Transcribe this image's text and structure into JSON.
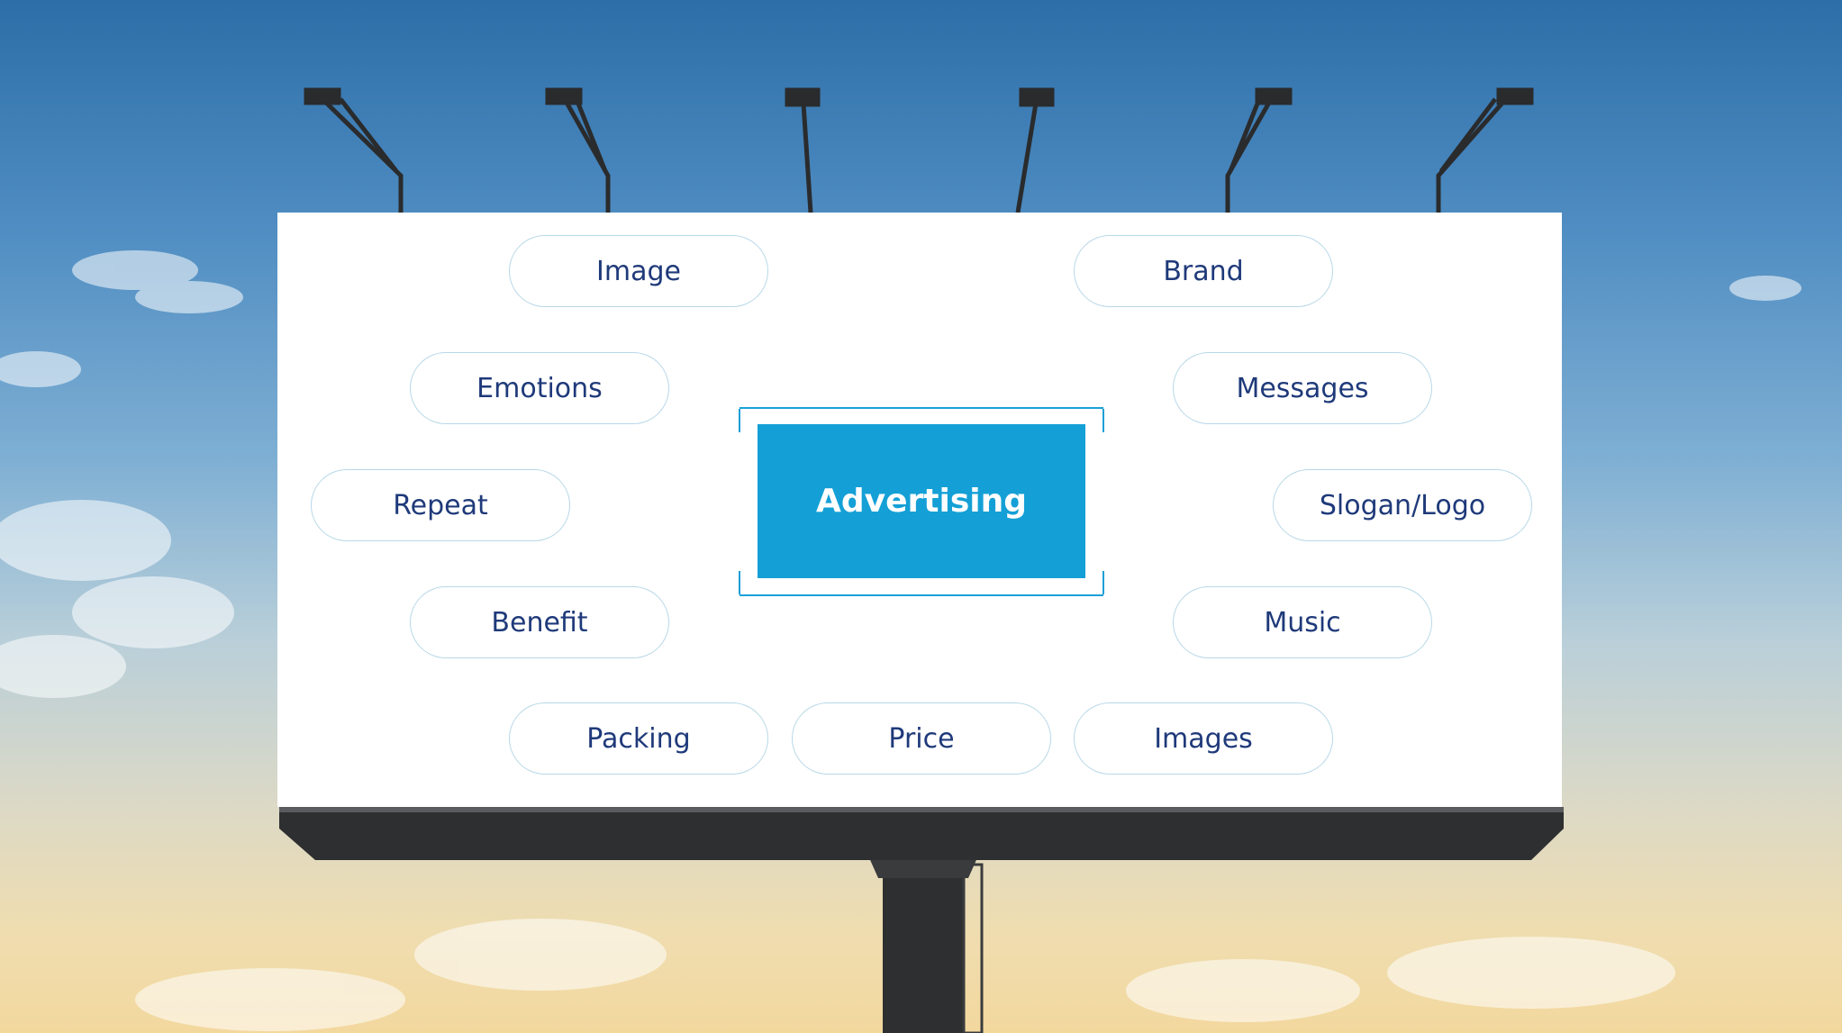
{
  "diagram": {
    "center_label": "Advertising",
    "nodes": [
      {
        "id": "image",
        "label": "Image"
      },
      {
        "id": "brand",
        "label": "Brand"
      },
      {
        "id": "emotions",
        "label": "Emotions"
      },
      {
        "id": "messages",
        "label": "Messages"
      },
      {
        "id": "repeat",
        "label": "Repeat"
      },
      {
        "id": "slogan-logo",
        "label": "Slogan/Logo"
      },
      {
        "id": "benefit",
        "label": "Benefit"
      },
      {
        "id": "music",
        "label": "Music"
      },
      {
        "id": "packing",
        "label": "Packing"
      },
      {
        "id": "price",
        "label": "Price"
      },
      {
        "id": "images",
        "label": "Images"
      }
    ]
  },
  "colors": {
    "accent": "#14a0d6",
    "text": "#1f3a7a",
    "pill_border": "#b8d8e8",
    "billboard_frame": "#2e2f31"
  }
}
